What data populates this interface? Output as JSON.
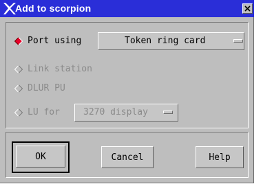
{
  "window": {
    "title": "Add to scorpion"
  },
  "options": [
    {
      "label": "Port using",
      "selected": true,
      "enabled": true
    },
    {
      "label": "Link station",
      "selected": false,
      "enabled": false
    },
    {
      "label": "DLUR PU",
      "selected": false,
      "enabled": false
    },
    {
      "label": "LU for",
      "selected": false,
      "enabled": false
    }
  ],
  "port_menu": {
    "value": "Token ring card"
  },
  "lu_menu": {
    "value": "3270 display"
  },
  "buttons": {
    "ok": "OK",
    "cancel": "Cancel",
    "help": "Help"
  },
  "colors": {
    "titlebar": "#2a2ed8",
    "dialog": "#bebebe",
    "radio_selected": "#e8002a"
  }
}
